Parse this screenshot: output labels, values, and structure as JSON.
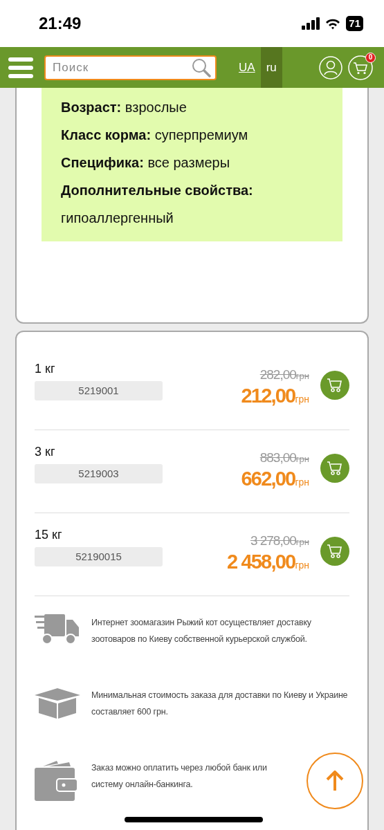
{
  "status_bar": {
    "time": "21:49",
    "battery": "71"
  },
  "header": {
    "search": {
      "placeholder": "Поиск"
    },
    "languages": [
      {
        "label": "UA",
        "selected": false
      },
      {
        "label": "ru",
        "selected": true
      }
    ],
    "cart_count": "0"
  },
  "attributes": [
    "**Возраст:** взрослые",
    "**Класс корма:** суперпремиум",
    "**Специфика:** все размеры",
    "**Дополнительные свойства:** гипоаллергенный"
  ],
  "variants": [
    {
      "weight": "1 кг",
      "code": "5219001",
      "old_price": "282,00",
      "old_currency": "грн",
      "price": "212,00",
      "currency": "грн"
    },
    {
      "weight": "3 кг",
      "code": "5219003",
      "old_price": "883,00",
      "old_currency": "грн",
      "price": "662,00",
      "currency": "грн"
    },
    {
      "weight": "15 кг",
      "code": "52190015",
      "old_price": "3 278,00",
      "old_currency": "грн",
      "price": "2 458,00",
      "currency": "грн"
    }
  ],
  "info": [
    {
      "kind": "truck",
      "text": "Интернет зоомагазин Рыжий кот осуществляет доставку зоотоваров по Киеву собственной курьерской службой."
    },
    {
      "kind": "box",
      "text": "Минимальная стоимость заказа для доставки по Киеву и Украине составляет 600 грн."
    },
    {
      "kind": "wallet",
      "text": "Заказ можно оплатить через любой банк или систему онлайн-банкинга."
    }
  ]
}
